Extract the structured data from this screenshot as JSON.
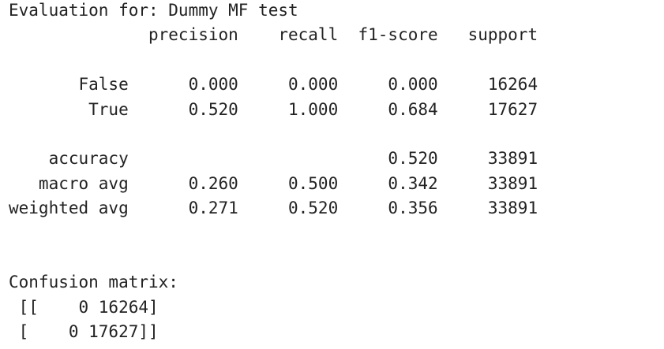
{
  "report": {
    "title_line": "Evaluation for: Dummy MF test",
    "header_line": "              precision    recall  f1-score   support",
    "blank_1": "",
    "row_false": "       False      0.000     0.000     0.000     16264",
    "row_true": "        True      0.520     1.000     0.684     17627",
    "blank_2": "",
    "row_accuracy": "    accuracy                          0.520     33891",
    "row_macro_avg": "   macro avg      0.260     0.500     0.342     33891",
    "row_weighted_avg": "weighted avg      0.271     0.520     0.356     33891",
    "blank_3": "",
    "blank_4": "",
    "confusion_title": "Confusion matrix:",
    "confusion_row_1": " [[    0 16264]",
    "confusion_row_2": " [    0 17627]]"
  }
}
